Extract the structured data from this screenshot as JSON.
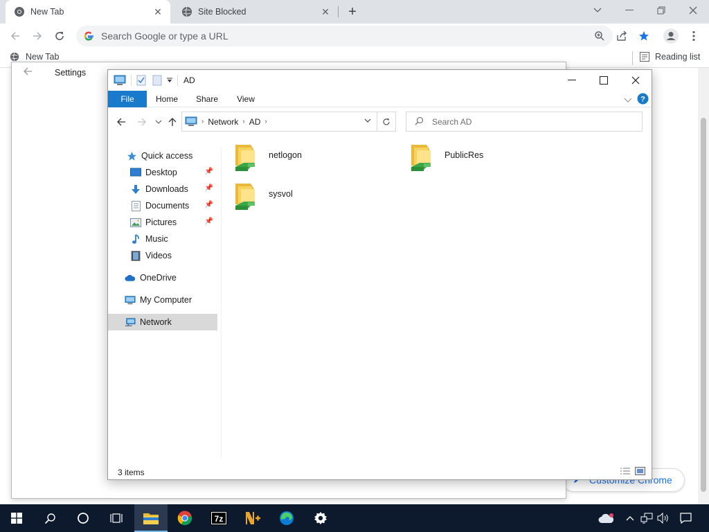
{
  "browser": {
    "tabs": [
      {
        "label": "New Tab",
        "active": true
      },
      {
        "label": "Site Blocked",
        "active": false
      }
    ],
    "omnibox_placeholder": "Search Google or type a URL",
    "bookmark": "New Tab",
    "reading_list": "Reading list",
    "customize_label": "Customize Chrome"
  },
  "settings": {
    "title": "Settings"
  },
  "explorer": {
    "title": "AD",
    "ribbon_tabs": [
      "File",
      "Home",
      "Share",
      "View"
    ],
    "breadcrumb": [
      "Network",
      "AD"
    ],
    "search_placeholder": "Search AD",
    "nav": {
      "quick_access": "Quick access",
      "desktop": "Desktop",
      "downloads": "Downloads",
      "documents": "Documents",
      "pictures": "Pictures",
      "music": "Music",
      "videos": "Videos",
      "onedrive": "OneDrive",
      "my_computer": "My Computer",
      "network": "Network"
    },
    "items": [
      "netlogon",
      "PublicRes",
      "sysvol"
    ],
    "status": "3 items"
  },
  "taskbar": {
    "apps": [
      "start-icon",
      "search-icon",
      "cortana-icon",
      "task-view-icon",
      "file-explorer-icon",
      "chrome-icon",
      "7zip-icon",
      "notepadpp-icon",
      "edge-icon",
      "settings-icon"
    ],
    "colors": {
      "bg": "#0d1a2e",
      "accent": "#1979ca"
    }
  }
}
